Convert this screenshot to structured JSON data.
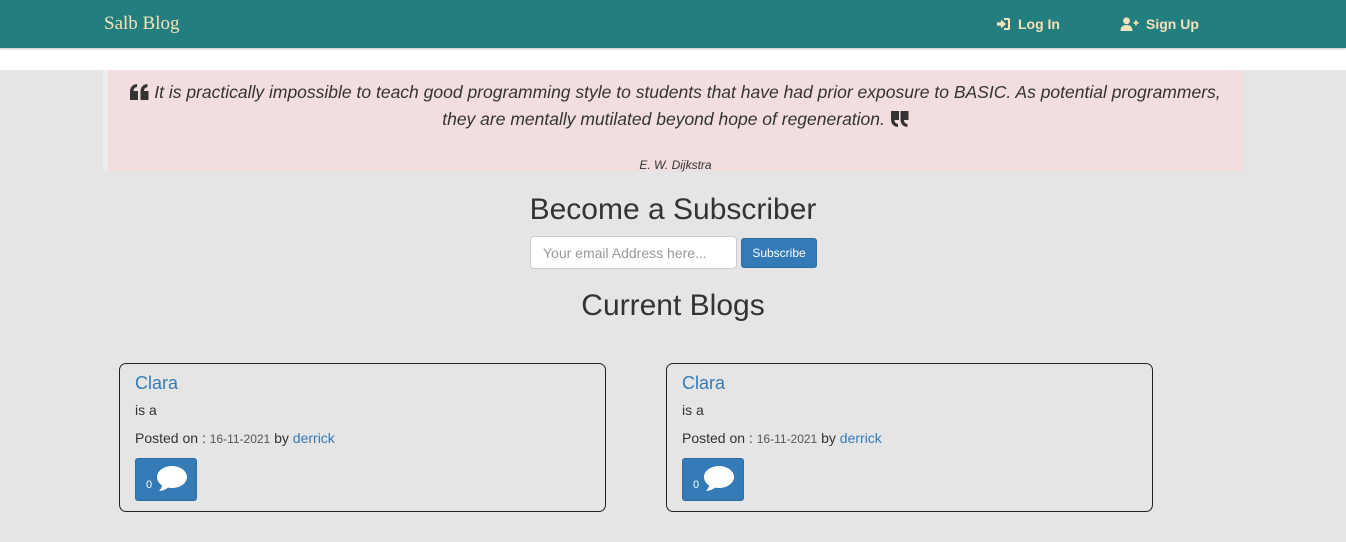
{
  "navbar": {
    "brand": "Salb Blog",
    "login_label": "Log In",
    "signup_label": "Sign Up",
    "background": "#237f7f",
    "text_color": "#f3e2bb"
  },
  "quote": {
    "text": "It is practically impossible to teach good programming style to students that have had prior exposure to BASIC. As potential programmers, they are mentally mutilated beyond hope of regeneration.",
    "author": "E. W. Dijkstra",
    "background": "#f2dede"
  },
  "subscribe": {
    "title": "Become a Subscriber",
    "email_placeholder": "Your email Address here...",
    "email_value": "",
    "button_label": "Subscribe"
  },
  "blogs": {
    "title": "Current Blogs",
    "posted_on_label": "Posted on :",
    "by_label": "by",
    "items": [
      {
        "title": "Clara",
        "excerpt": "is a",
        "date": "16-11-2021",
        "author": "derrick",
        "comment_count": "0"
      },
      {
        "title": "Clara",
        "excerpt": "is a",
        "date": "16-11-2021",
        "author": "derrick",
        "comment_count": "0"
      }
    ]
  },
  "icons": {
    "login": "sign-in-icon",
    "signup": "user-plus-icon",
    "quote_open": "quote-left-icon",
    "quote_close": "quote-right-icon",
    "comment": "comment-icon"
  },
  "colors": {
    "page_background": "#e5e5e5",
    "primary": "#337ab7",
    "link": "#337ab7"
  }
}
